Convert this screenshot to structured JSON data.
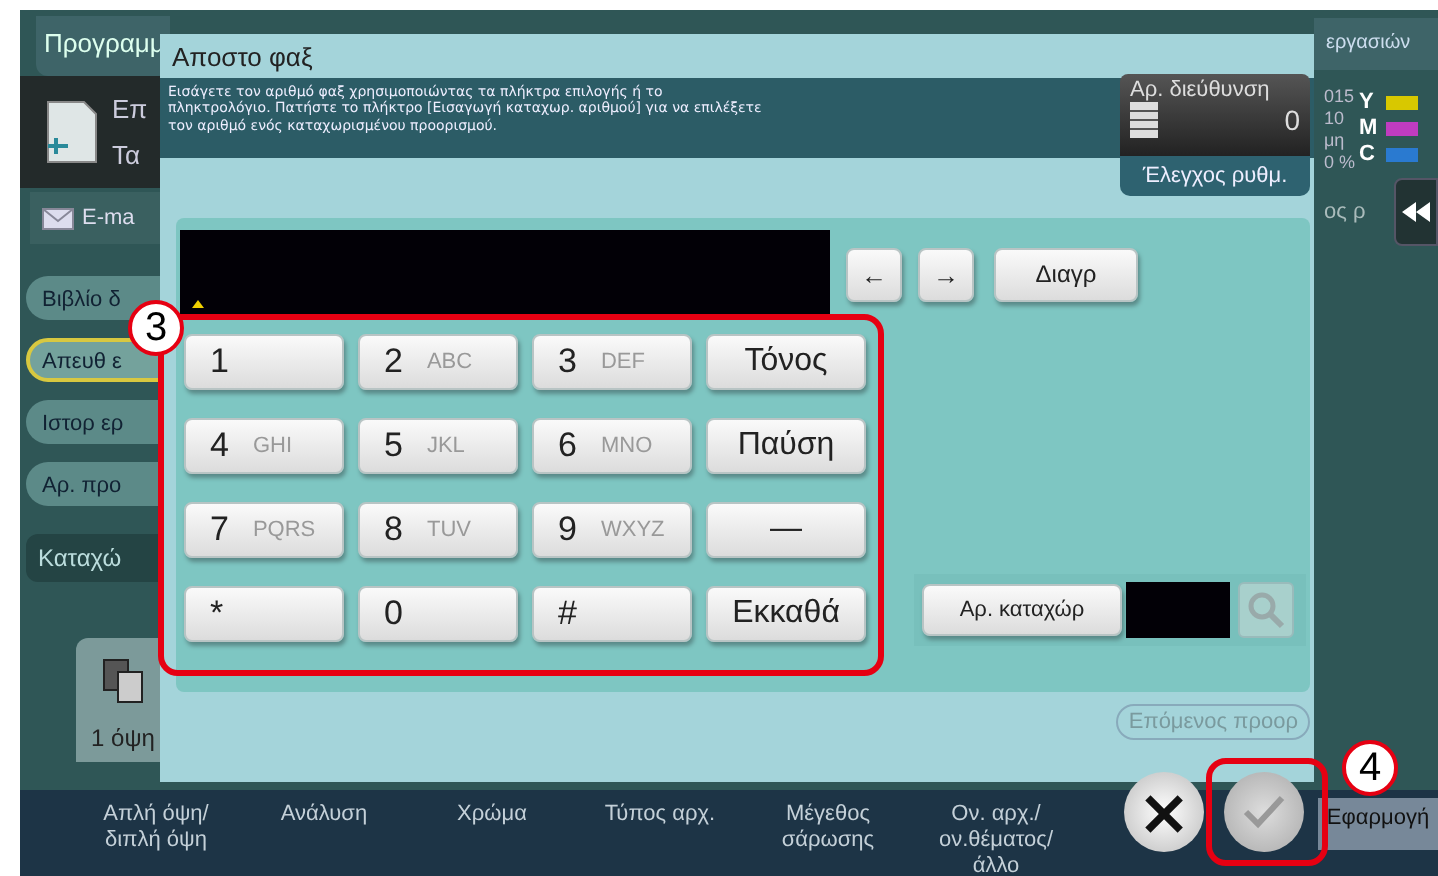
{
  "background": {
    "top_tab": "Προγραμμ",
    "mode_item": {
      "title": "Επ",
      "subtitle": "Τα"
    },
    "email_item": "E-ma",
    "side_items": [
      {
        "label": "Βιβλίο δ",
        "selected": false
      },
      {
        "label": "Απευθ ε",
        "selected": true
      },
      {
        "label": "Ιστορ ερ",
        "selected": false
      },
      {
        "label": "Αρ. προ",
        "selected": false
      }
    ],
    "register_item": "Καταχώ",
    "duplex_item": "1 όψη",
    "job_list_tab": "εργασιών",
    "status_lines": [
      "015",
      "10",
      "μη",
      "0 %"
    ],
    "toners": [
      {
        "label": "Y",
        "color": "#d8c800"
      },
      {
        "label": "M",
        "color": "#c03cc0"
      },
      {
        "label": "C",
        "color": "#2a7ad0"
      }
    ],
    "status_text": "ος ρ",
    "bottom_tabs": [
      "Απλή όψη/ διπλή όψη",
      "Ανάλυση",
      "Χρώμα",
      "Τύπος αρχ.",
      "Μέγεθος σάρωσης",
      "Ον. αρχ./ ον.θέματος/ άλλο"
    ],
    "apply_tab": "Εφαρμογή"
  },
  "dialog": {
    "title": "Αποστο φαξ",
    "instruction": "Εισάγετε τον αριθμό φαξ χρησιμοποιώντας τα πλήκτρα επιλογής ή το πληκτρολόγιο. Πατήστε το πλήκτρο [Εισαγωγή καταχωρ. αριθμού] για να επιλέξετε τον αριθμό ενός καταχωρισμένου προορισμού.",
    "address_label": "Αρ. διεύθυνση",
    "address_count": "0",
    "check_button": "Έλεγχος ρυθμ.",
    "left_arrow": "←",
    "right_arrow": "→",
    "delete_button": "Διαγρ",
    "keys": [
      {
        "kind": "digit",
        "main": "1"
      },
      {
        "kind": "digit",
        "main": "2",
        "sub": "ABC"
      },
      {
        "kind": "digit",
        "main": "3",
        "sub": "DEF"
      },
      {
        "kind": "function",
        "main": "Τόνος"
      },
      {
        "kind": "digit",
        "main": "4",
        "sub": "GHI"
      },
      {
        "kind": "digit",
        "main": "5",
        "sub": "JKL"
      },
      {
        "kind": "digit",
        "main": "6",
        "sub": "MNO"
      },
      {
        "kind": "function",
        "main": "Παύση"
      },
      {
        "kind": "digit",
        "main": "7",
        "sub": "PQRS"
      },
      {
        "kind": "digit",
        "main": "8",
        "sub": "TUV"
      },
      {
        "kind": "digit",
        "main": "9",
        "sub": "WXYZ"
      },
      {
        "kind": "function",
        "main": "—"
      },
      {
        "kind": "digit",
        "main": "*"
      },
      {
        "kind": "digit",
        "main": "0"
      },
      {
        "kind": "digit",
        "main": "#"
      },
      {
        "kind": "function",
        "main": "Εκκαθά"
      }
    ],
    "registered_button": "Αρ. καταχώρ",
    "next_button": {
      "label": "Επόμενος προορ",
      "disabled": true
    },
    "cancel_symbol": "×",
    "ok_disabled": true
  },
  "callouts": [
    "3",
    "4"
  ]
}
